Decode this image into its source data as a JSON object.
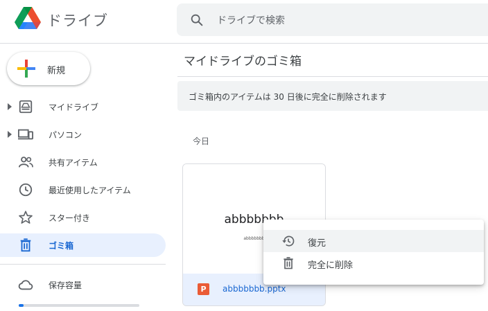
{
  "app": {
    "name": "ドライブ"
  },
  "search": {
    "placeholder": "ドライブで検索"
  },
  "sidebar": {
    "new_label": "新規",
    "items": [
      {
        "label": "マイドライブ"
      },
      {
        "label": "パソコン"
      },
      {
        "label": "共有アイテム"
      },
      {
        "label": "最近使用したアイテム"
      },
      {
        "label": "スター付き"
      },
      {
        "label": "ゴミ箱"
      }
    ],
    "storage_label": "保存容量",
    "storage_used_percent": 4
  },
  "main": {
    "title": "マイドライブのゴミ箱",
    "notice": "ゴミ箱内のアイテムは 30 日後に完全に削除されます",
    "section_label": "今日",
    "file": {
      "preview_title": "abbbbbbb",
      "preview_subtitle": "abbbbbbb",
      "type_icon_text": "P",
      "name": "abbbbbbb.pptx"
    }
  },
  "context_menu": {
    "items": [
      {
        "label": "復元"
      },
      {
        "label": "完全に削除"
      }
    ]
  },
  "colors": {
    "accent": "#1a73e8",
    "active_bg": "#e8f0fe",
    "active_text": "#1967d2",
    "pptx": "#ea5b36"
  }
}
